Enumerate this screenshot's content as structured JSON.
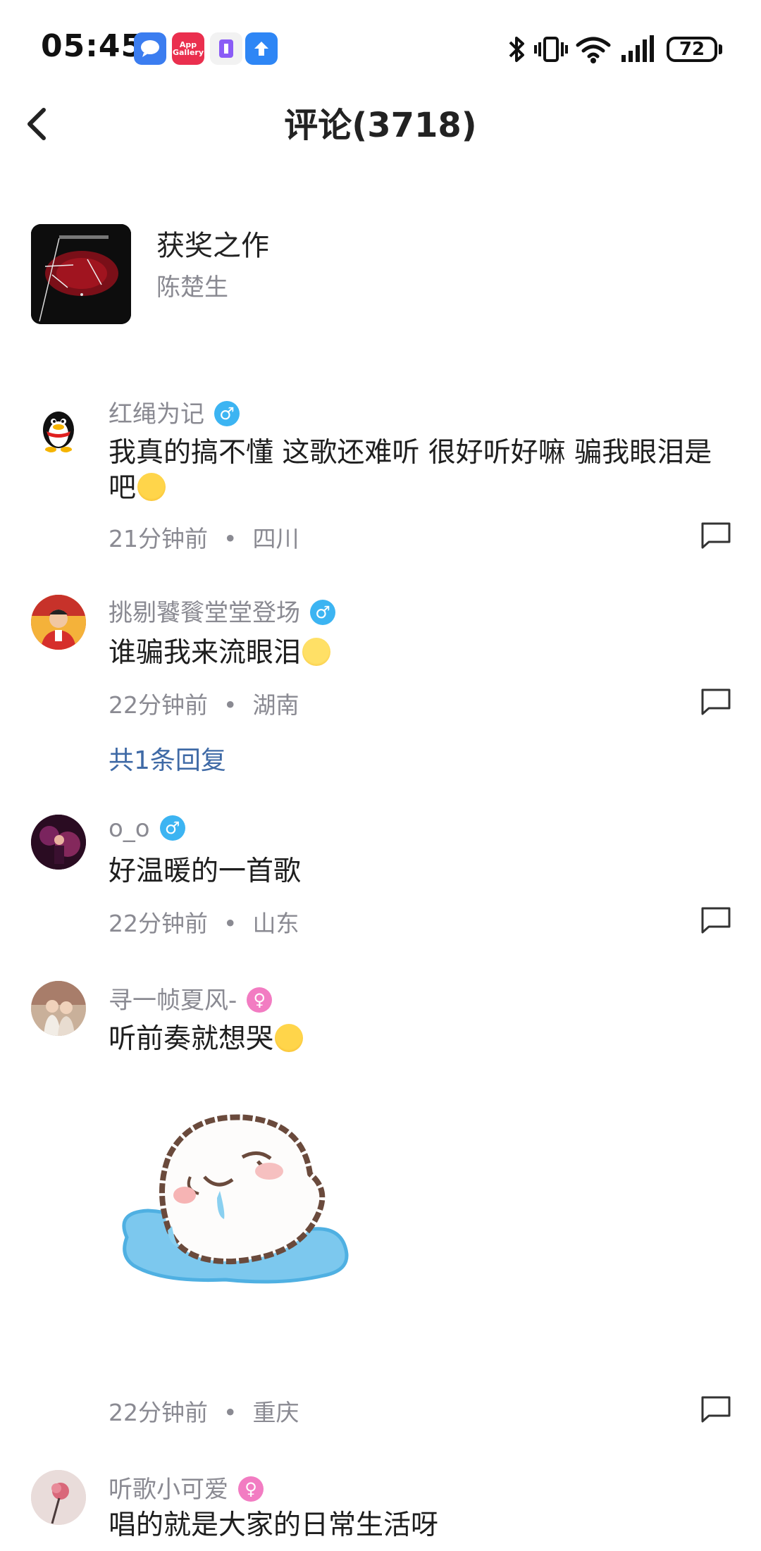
{
  "status_bar": {
    "time": "05:45",
    "notification_icons": [
      "messages-icon",
      "app-gallery-icon",
      "app-icon",
      "upload-icon"
    ],
    "app_gallery_label": "App Gallery",
    "battery": "72"
  },
  "header": {
    "title": "评论(3718)"
  },
  "song": {
    "title": "获奖之作",
    "artist": "陈楚生"
  },
  "comments": [
    {
      "username": "红绳为记",
      "gender": "male",
      "text": "我真的搞不懂 这歌还难听 很好听好嘛 骗我眼泪是吧",
      "emoji": "crying-emoji",
      "time": "21分钟前",
      "location": "四川"
    },
    {
      "username": "挑剔饕餮堂堂登场",
      "gender": "male",
      "text": "谁骗我来流眼泪",
      "emoji": "smile-emoji",
      "time": "22分钟前",
      "location": "湖南",
      "replies_label": "共1条回复"
    },
    {
      "username": "o_o",
      "gender": "male",
      "text": "好温暖的一首歌",
      "time": "22分钟前",
      "location": "山东"
    },
    {
      "username": "寻一帧夏风-",
      "gender": "female",
      "text": "听前奏就想哭",
      "emoji": "crying-emoji",
      "sticker": "crying-seal-sticker",
      "time": "22分钟前",
      "location": "重庆"
    },
    {
      "username": "听歌小可爱",
      "gender": "female",
      "text": "唱的就是大家的日常生活呀"
    }
  ],
  "colors": {
    "accent_link": "#3f6aa6",
    "secondary_text": "#8a8a92",
    "male_badge": "#3cb4f2",
    "female_badge": "#f27cc2"
  }
}
